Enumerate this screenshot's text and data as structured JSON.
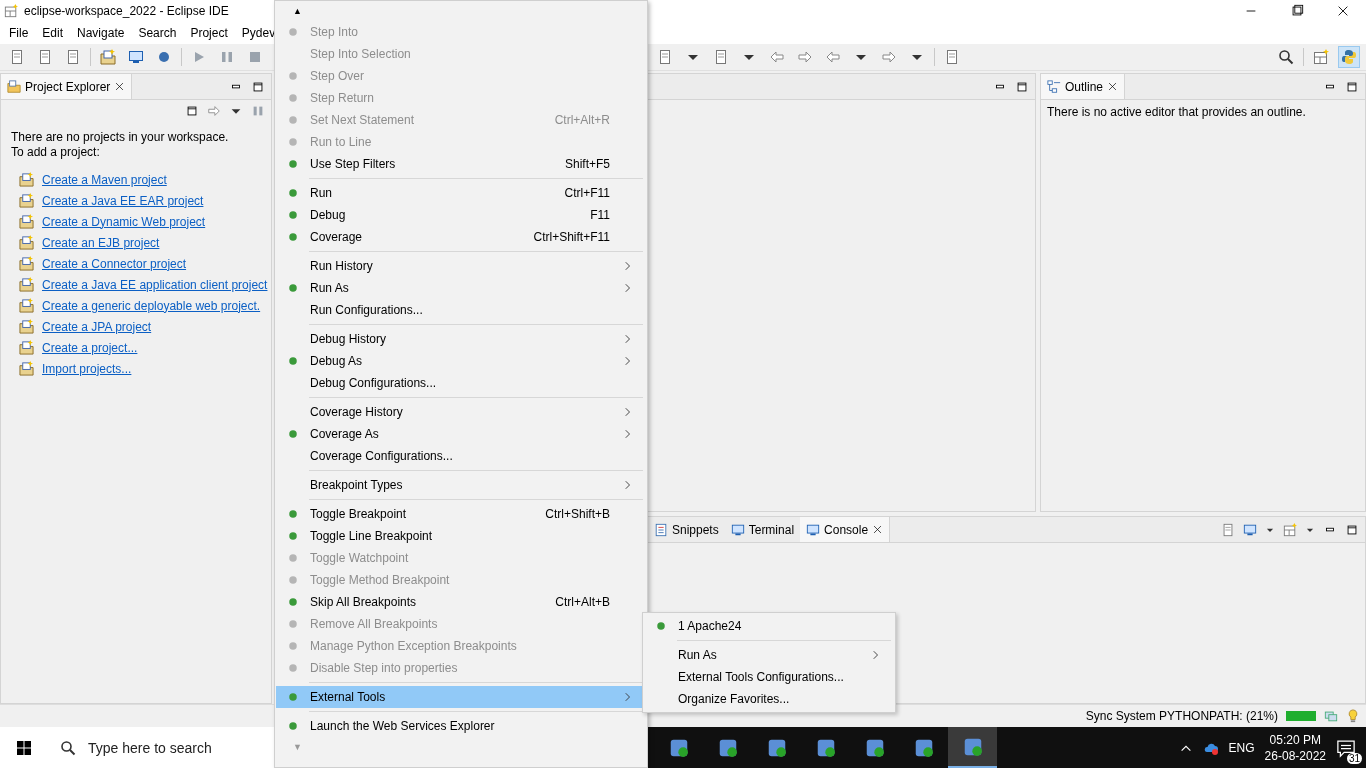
{
  "window": {
    "title": "eclipse-workspace_2022 - Eclipse IDE"
  },
  "menubar": [
    {
      "label": "File"
    },
    {
      "label": "Edit"
    },
    {
      "label": "Navigate"
    },
    {
      "label": "Search"
    },
    {
      "label": "Project"
    },
    {
      "label": "Pydev"
    }
  ],
  "project_explorer": {
    "tab": {
      "label": "Project Explorer",
      "selected": true
    },
    "intro": "There are no projects in your workspace.",
    "prompt": "To add a project:",
    "links": [
      {
        "label": "Create a Maven project"
      },
      {
        "label": "Create a Java EE EAR project"
      },
      {
        "label": "Create a Dynamic Web project"
      },
      {
        "label": "Create an EJB project"
      },
      {
        "label": "Create a Connector project"
      },
      {
        "label": "Create a Java EE application client project"
      },
      {
        "label": "Create a generic deployable web project."
      },
      {
        "label": "Create a JPA project"
      },
      {
        "label": "Create a project..."
      },
      {
        "label": "Import projects..."
      }
    ]
  },
  "outline": {
    "tab": {
      "label": "Outline",
      "selected": true
    },
    "message": "There is no active editor that provides an outline."
  },
  "console": {
    "tabs": [
      {
        "label": "Snippets",
        "selected": false
      },
      {
        "label": "Terminal",
        "selected": false
      },
      {
        "label": "Console",
        "selected": true
      }
    ]
  },
  "run_menu": {
    "scroll_up": "▲",
    "scroll_down": "▼",
    "items": [
      {
        "kind": "item",
        "label": "Step Into",
        "disabled": true,
        "icon": true
      },
      {
        "kind": "item",
        "label": "Step Into Selection",
        "disabled": true,
        "icon": false
      },
      {
        "kind": "item",
        "label": "Step Over",
        "disabled": true,
        "icon": true
      },
      {
        "kind": "item",
        "label": "Step Return",
        "disabled": true,
        "icon": true
      },
      {
        "kind": "item",
        "label": "Set Next Statement",
        "shortcut": "Ctrl+Alt+R",
        "disabled": true,
        "icon": true
      },
      {
        "kind": "item",
        "label": "Run to Line",
        "disabled": true,
        "icon": true
      },
      {
        "kind": "item",
        "label": "Use Step Filters",
        "shortcut": "Shift+F5",
        "disabled": false,
        "icon": true
      },
      {
        "kind": "separator"
      },
      {
        "kind": "item",
        "label": "Run",
        "shortcut": "Ctrl+F11",
        "disabled": false,
        "icon": true
      },
      {
        "kind": "item",
        "label": "Debug",
        "shortcut": "F11",
        "disabled": false,
        "icon": true
      },
      {
        "kind": "item",
        "label": "Coverage",
        "shortcut": "Ctrl+Shift+F11",
        "disabled": false,
        "icon": true
      },
      {
        "kind": "separator"
      },
      {
        "kind": "item",
        "label": "Run History",
        "disabled": false,
        "icon": false,
        "submenu": true
      },
      {
        "kind": "item",
        "label": "Run As",
        "disabled": false,
        "icon": true,
        "submenu": true
      },
      {
        "kind": "item",
        "label": "Run Configurations...",
        "disabled": false,
        "icon": false
      },
      {
        "kind": "separator"
      },
      {
        "kind": "item",
        "label": "Debug History",
        "disabled": false,
        "icon": false,
        "submenu": true
      },
      {
        "kind": "item",
        "label": "Debug As",
        "disabled": false,
        "icon": true,
        "submenu": true
      },
      {
        "kind": "item",
        "label": "Debug Configurations...",
        "disabled": false,
        "icon": false
      },
      {
        "kind": "separator"
      },
      {
        "kind": "item",
        "label": "Coverage History",
        "disabled": false,
        "icon": false,
        "submenu": true
      },
      {
        "kind": "item",
        "label": "Coverage As",
        "disabled": false,
        "icon": true,
        "submenu": true
      },
      {
        "kind": "item",
        "label": "Coverage Configurations...",
        "disabled": false,
        "icon": false
      },
      {
        "kind": "separator"
      },
      {
        "kind": "item",
        "label": "Breakpoint Types",
        "disabled": false,
        "icon": false,
        "submenu": true
      },
      {
        "kind": "separator"
      },
      {
        "kind": "item",
        "label": "Toggle Breakpoint",
        "shortcut": "Ctrl+Shift+B",
        "disabled": false,
        "icon": true
      },
      {
        "kind": "item",
        "label": "Toggle Line Breakpoint",
        "disabled": false,
        "icon": true
      },
      {
        "kind": "item",
        "label": "Toggle Watchpoint",
        "disabled": true,
        "icon": true
      },
      {
        "kind": "item",
        "label": "Toggle Method Breakpoint",
        "disabled": true,
        "icon": true
      },
      {
        "kind": "item",
        "label": "Skip All Breakpoints",
        "shortcut": "Ctrl+Alt+B",
        "disabled": false,
        "icon": true
      },
      {
        "kind": "item",
        "label": "Remove All Breakpoints",
        "disabled": true,
        "icon": true
      },
      {
        "kind": "item",
        "label": "Manage Python Exception Breakpoints",
        "disabled": true,
        "icon": true
      },
      {
        "kind": "item",
        "label": "Disable Step into properties",
        "disabled": true,
        "icon": true
      },
      {
        "kind": "separator"
      },
      {
        "kind": "item",
        "label": "External Tools",
        "disabled": false,
        "icon": true,
        "submenu": true,
        "selected": true
      },
      {
        "kind": "separator"
      },
      {
        "kind": "item",
        "label": "Launch the Web Services Explorer",
        "disabled": false,
        "icon": true
      }
    ]
  },
  "submenu": {
    "items": [
      {
        "kind": "item",
        "label": "1 Apache24",
        "icon": true
      },
      {
        "kind": "separator"
      },
      {
        "kind": "item",
        "label": "Run As",
        "icon": false,
        "submenu": true
      },
      {
        "kind": "item",
        "label": "External Tools Configurations...",
        "icon": false
      },
      {
        "kind": "item",
        "label": "Organize Favorites...",
        "icon": false
      }
    ]
  },
  "status_bar": {
    "task": "Sync System PYTHONPATH: (21%)",
    "level": 1
  },
  "taskbar": {
    "search": {
      "placeholder": "Type here to search"
    },
    "apps": [
      {
        "selected": false
      },
      {
        "selected": false
      },
      {
        "selected": false
      },
      {
        "selected": false
      },
      {
        "selected": false
      },
      {
        "selected": false
      },
      {
        "selected": true
      }
    ],
    "language": "ENG",
    "time": "05:20 PM",
    "date": "26-08-2022",
    "notifications": "31"
  }
}
